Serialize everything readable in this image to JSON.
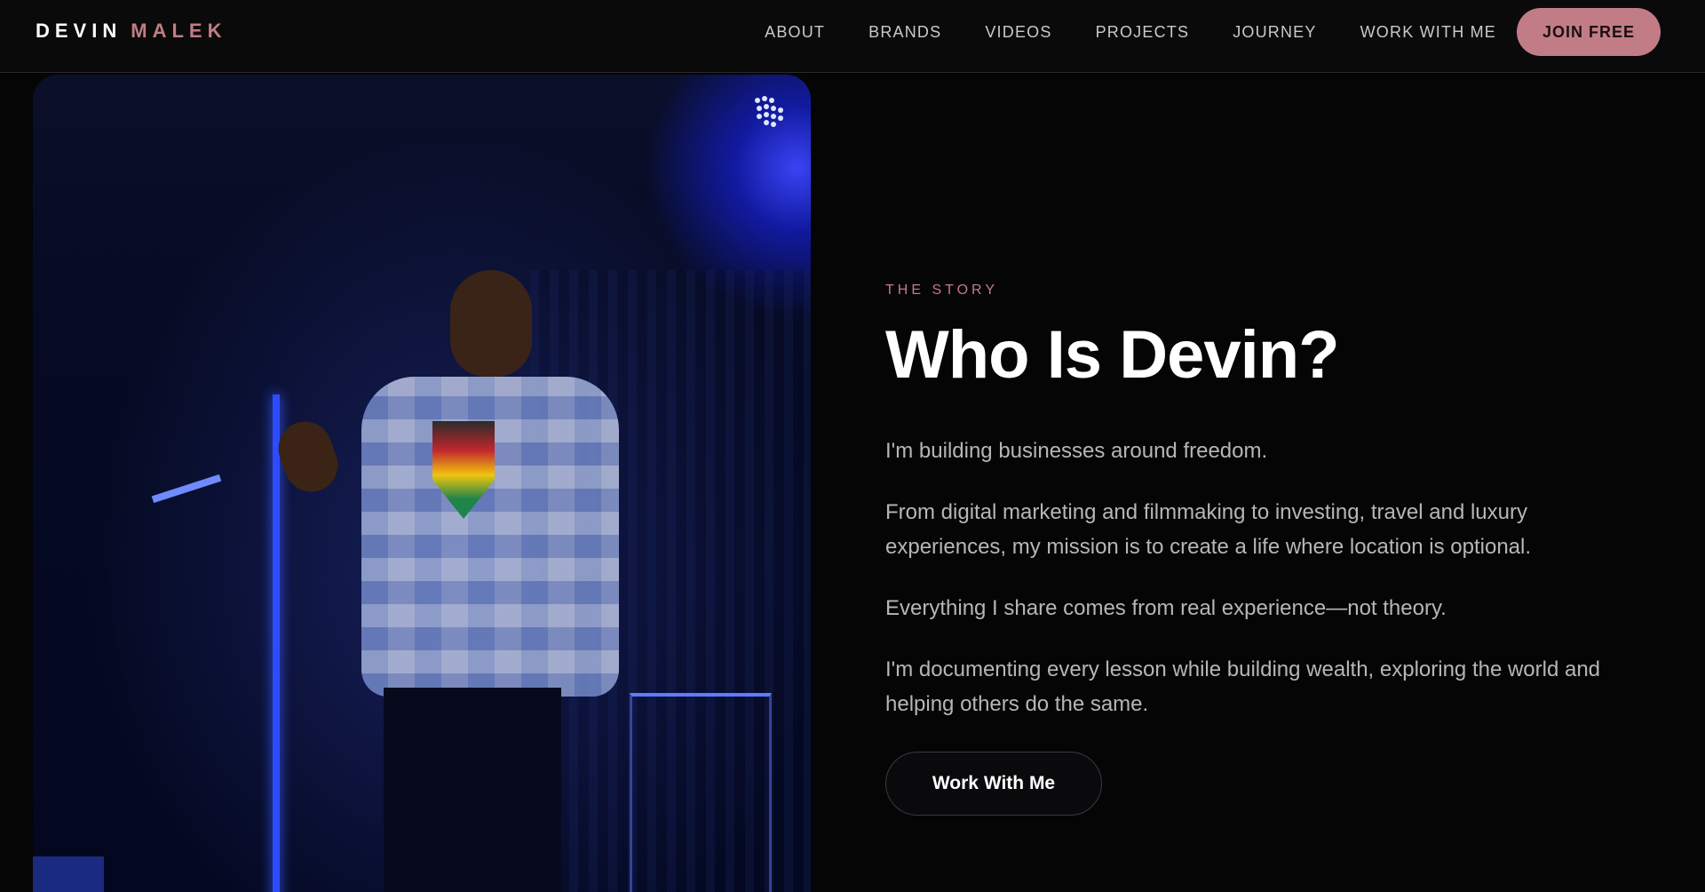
{
  "header": {
    "brand_first": "DEVIN",
    "brand_last": "MALEK",
    "nav": [
      "ABOUT",
      "BRANDS",
      "VIDEOS",
      "PROJECTS",
      "JOURNEY",
      "WORK WITH ME"
    ],
    "join_label": "JOIN FREE"
  },
  "story": {
    "eyebrow": "THE STORY",
    "title": "Who Is Devin?",
    "paragraphs": [
      "I'm building businesses around freedom.",
      "From digital marketing and filmmaking to investing, travel and luxury experiences, my mission is to create a life where location is optional.",
      "Everything I share comes from real experience—not theory.",
      "I'm documenting every lesson while building wealth, exploring the world and helping others do the same."
    ],
    "cta_label": "Work With Me"
  },
  "colors": {
    "background": "#050506",
    "accent": "#c27c86",
    "text": "#ffffff",
    "muted": "#b6b6ba"
  },
  "icons": {
    "photo_badge": "grid-dots-icon"
  }
}
